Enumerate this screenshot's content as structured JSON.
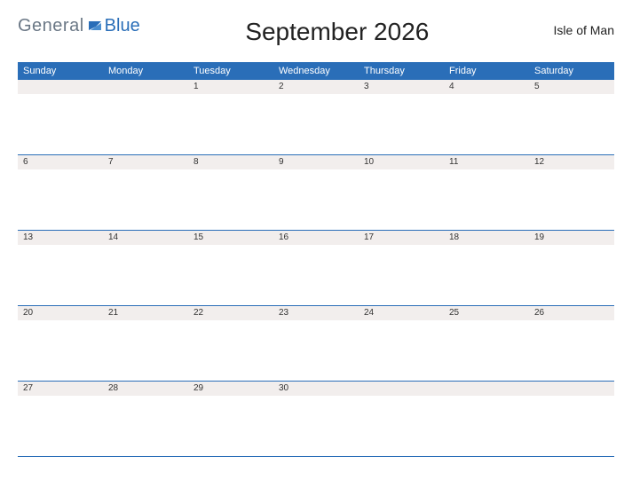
{
  "logo": {
    "part1": "General",
    "part2": "Blue"
  },
  "title": "September 2026",
  "region": "Isle of Man",
  "colors": {
    "brand": "#2a6eb8",
    "daybg": "#f2eeed"
  },
  "dayHeaders": [
    "Sunday",
    "Monday",
    "Tuesday",
    "Wednesday",
    "Thursday",
    "Friday",
    "Saturday"
  ],
  "weeks": [
    [
      "",
      "",
      "1",
      "2",
      "3",
      "4",
      "5"
    ],
    [
      "6",
      "7",
      "8",
      "9",
      "10",
      "11",
      "12"
    ],
    [
      "13",
      "14",
      "15",
      "16",
      "17",
      "18",
      "19"
    ],
    [
      "20",
      "21",
      "22",
      "23",
      "24",
      "25",
      "26"
    ],
    [
      "27",
      "28",
      "29",
      "30",
      "",
      "",
      ""
    ]
  ]
}
